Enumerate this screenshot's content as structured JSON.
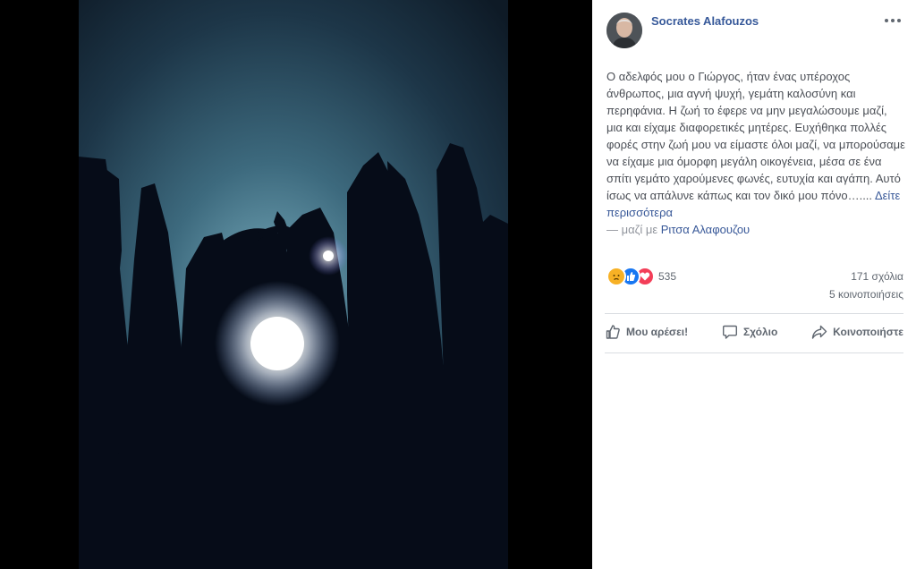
{
  "post": {
    "author": "Socrates Alafouzos",
    "text": "Ο αδελφός μου ο Γιώργος, ήταν ένας υπέροχος άνθρωπος, μια αγνή ψυχή, γεμάτη καλοσύνη και περηφάνια. Η ζωή το έφερε να μην μεγαλώσουμε μαζί, μια και είχαμε διαφορετικές μητέρες. Ευχήθηκα πολλές φορές στην ζωή μου να είμαστε όλοι μαζί, να μπορούσαμε να είχαμε μια όμορφη μεγάλη οικογένεια, μέσα σε ένα σπίτι γεμάτο χαρούμενες φωνές, ευτυχία και αγάπη. Αυτό ίσως να απάλυνε κάπως και τον δικό μου πόνο…....",
    "see_more": "Δείτε περισσότερα",
    "with_prefix": "— μαζί με",
    "tagged_person": "Ριτσα Αλαφουζου"
  },
  "stats": {
    "reaction_count": "535",
    "reaction_icons": [
      "sad-icon",
      "like-icon",
      "love-icon"
    ],
    "comments": "171 σχόλια",
    "shares": "5 κοινοποιήσεις"
  },
  "actions": {
    "like": "Μου αρέσει!",
    "comment": "Σχόλιο",
    "share": "Κοινοποιήστε"
  },
  "colors": {
    "link": "#365899",
    "text": "#4b4f56",
    "muted": "#606770",
    "like_blue": "#1877f2",
    "love_red": "#f33e58",
    "sad_yellow": "#f7b125"
  }
}
